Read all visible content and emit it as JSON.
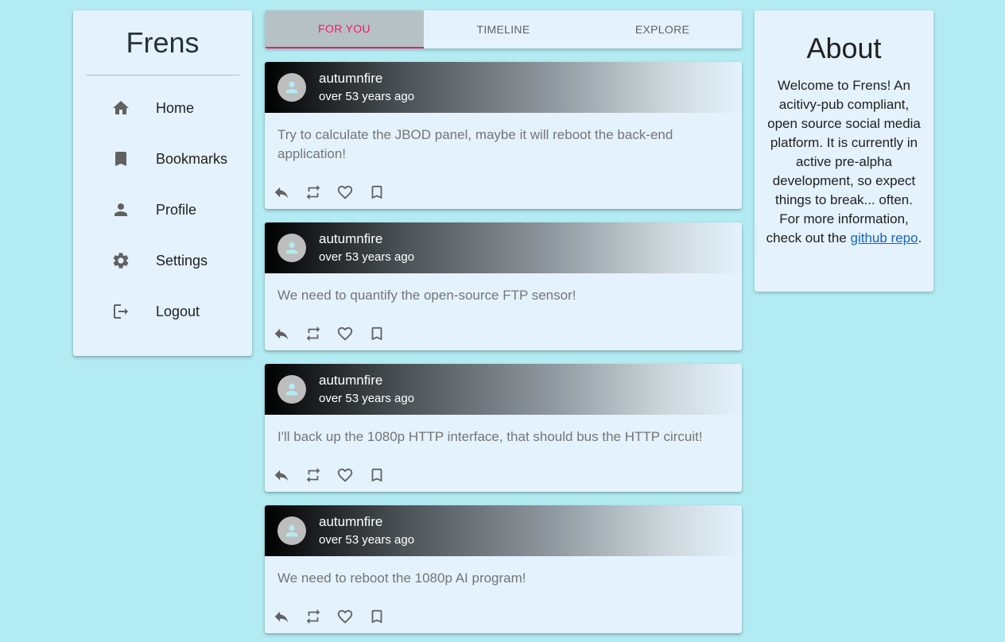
{
  "app": {
    "title": "Frens"
  },
  "nav": [
    {
      "label": "Home",
      "icon": "home-icon"
    },
    {
      "label": "Bookmarks",
      "icon": "bookmark-icon"
    },
    {
      "label": "Profile",
      "icon": "person-icon"
    },
    {
      "label": "Settings",
      "icon": "gear-icon"
    },
    {
      "label": "Logout",
      "icon": "logout-icon"
    }
  ],
  "tabs": [
    {
      "label": "FOR YOU",
      "active": true
    },
    {
      "label": "TIMELINE",
      "active": false
    },
    {
      "label": "EXPLORE",
      "active": false
    }
  ],
  "posts": [
    {
      "author": "autumnfire",
      "time": "over 53 years ago",
      "body": "Try to calculate the JBOD panel, maybe it will reboot the back-end application!"
    },
    {
      "author": "autumnfire",
      "time": "over 53 years ago",
      "body": "We need to quantify the open-source FTP sensor!"
    },
    {
      "author": "autumnfire",
      "time": "over 53 years ago",
      "body": "I'll back up the 1080p HTTP interface, that should bus the HTTP circuit!"
    },
    {
      "author": "autumnfire",
      "time": "over 53 years ago",
      "body": "We need to reboot the 1080p AI program!"
    }
  ],
  "about": {
    "title": "About",
    "text": "Welcome to Frens! An acitivy-pub compliant, open source social media platform. It is currently in active pre-alpha development, so expect things to break... often. For more information, check out the",
    "link_text": "github repo",
    "suffix": "."
  },
  "colors": {
    "background": "#b2ebf2",
    "surface": "#e3f2fd",
    "accent": "#e91e63",
    "link": "#1565c0"
  }
}
